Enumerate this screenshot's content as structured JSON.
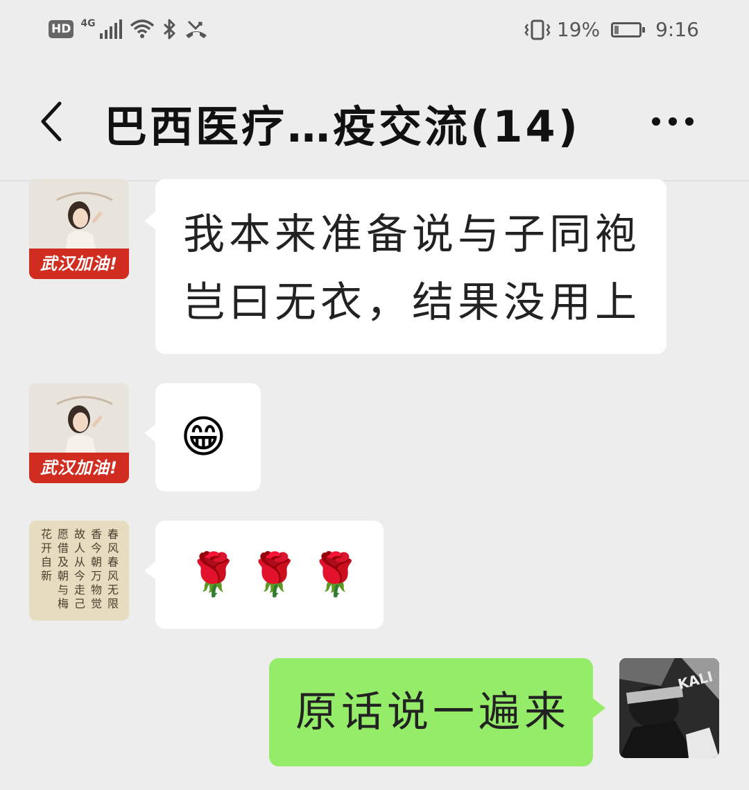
{
  "status_bar": {
    "hd_label": "HD",
    "network_label": "4G",
    "battery_percent_text": "19%",
    "battery_level": 0.19,
    "time": "9:16"
  },
  "header": {
    "title": "巴西医疗…疫交流(14)"
  },
  "messages": [
    {
      "direction": "incoming",
      "avatar_banner": "武汉加油!",
      "lines": [
        "我本来准备说与子同袍",
        "岂曰无衣，结果没用上"
      ]
    },
    {
      "direction": "incoming",
      "avatar_banner": "武汉加油!",
      "emoji": "😁"
    },
    {
      "direction": "incoming",
      "avatar_calligraphy_columns": [
        "春风春风无限",
        "香今朝万物觉",
        "故人从今走己",
        "愿借及朝与梅",
        "花开自新"
      ],
      "emojis": [
        "🌹",
        "🌹",
        "🌹"
      ]
    },
    {
      "direction": "outgoing",
      "avatar_label": "KALI",
      "text": "原话说一遍来"
    }
  ]
}
